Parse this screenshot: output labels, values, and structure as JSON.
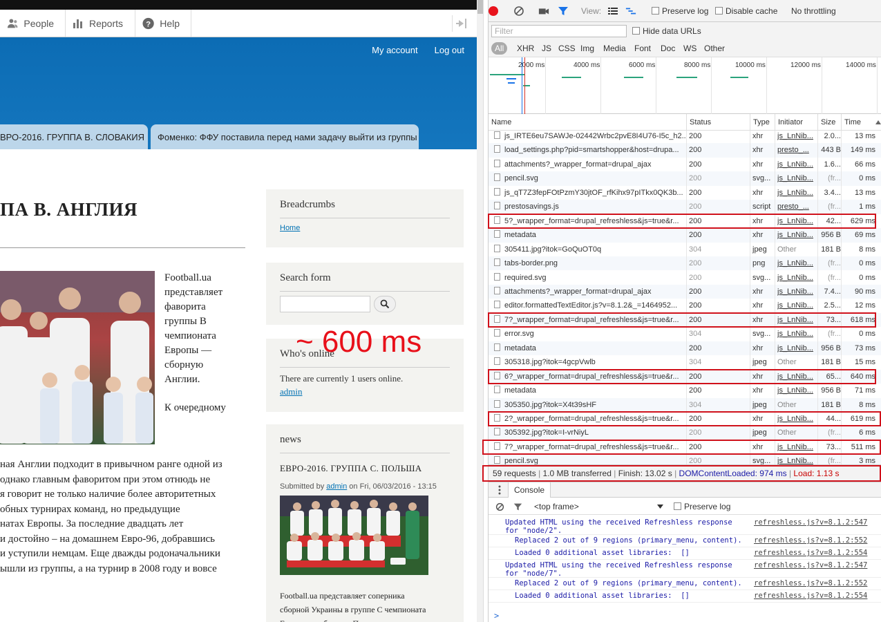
{
  "site": {
    "toolbar": {
      "people": "People",
      "reports": "Reports",
      "help": "Help"
    },
    "nav": {
      "my_account": "My account",
      "log_out": "Log out"
    },
    "tabs": [
      "ВРО-2016. ГРУППА В. СЛОВАКИЯ",
      "Фоменко: ФФУ поставила перед нами задачу выйти из группы"
    ],
    "main_title": "ПА В. АНГЛИЯ",
    "lead_lines": [
      "Football.ua",
      "представляет",
      "фаворита",
      "группы B",
      "чемпионата",
      "Европы —",
      "сборную",
      "Англии."
    ],
    "lead_cont": "К очередному",
    "body_lines": [
      "ная Англии подходит в привычном ранге одной из",
      "однако главным фаворитом при этом отнюдь не",
      "я говорит не только наличие более авторитетных",
      "обных турнирах команд, но предыдущие",
      "натах Европы. За последние двадцать лет",
      "и достойно – на домашнем Евро-96, добравшись",
      "и уступили немцам. Еще дважды родоначальники",
      "ышли из группы, а на турнир в 2008 году и вовсе"
    ],
    "blocks": {
      "breadcrumbs": {
        "title": "Breadcrumbs",
        "link": "Home"
      },
      "search": {
        "title": "Search form"
      },
      "online": {
        "title": "Who's online",
        "text": "There are currently 1 users online.",
        "user": "admin"
      },
      "news": {
        "title": "news",
        "item_title": "ЕВРО-2016. ГРУППА С. ПОЛЬША",
        "meta_prefix": "Submitted by",
        "meta_author": "admin",
        "meta_suffix": "on Fri, 06/03/2016 - 13:15",
        "text_lines": [
          "Football.ua представляет соперника",
          "сборной Украины в группе С чемпионата",
          "Европы — сборную Польши"
        ]
      }
    },
    "annotation": "~ 600 ms"
  },
  "devtools": {
    "toolbar": {
      "view": "View:",
      "preserve_log": "Preserve log",
      "disable_cache": "Disable cache",
      "throttling": "No throttling"
    },
    "filter": {
      "placeholder": "Filter",
      "hide_data_urls": "Hide data URLs"
    },
    "types": [
      "All",
      "XHR",
      "JS",
      "CSS",
      "Img",
      "Media",
      "Font",
      "Doc",
      "WS",
      "Other"
    ],
    "overview_ticks": [
      "2000 ms",
      "4000 ms",
      "6000 ms",
      "8000 ms",
      "10000 ms",
      "12000 ms",
      "14000 ms"
    ],
    "columns": [
      "Name",
      "Status",
      "Type",
      "Initiator",
      "Size",
      "Time"
    ],
    "rows": [
      {
        "name": "js_IRTE6eu7SAWJe-02442Wrbc2pvE8I4U76-I5c_h2...",
        "status": "200",
        "type": "xhr",
        "initiator": "js_LnNib...",
        "size": "2.0...",
        "time": "13 ms"
      },
      {
        "name": "load_settings.php?pid=smartshopper&host=drupa...",
        "status": "200",
        "type": "xhr",
        "initiator": "presto_...",
        "size": "443 B",
        "time": "149 ms"
      },
      {
        "name": "attachments?_wrapper_format=drupal_ajax",
        "status": "200",
        "type": "xhr",
        "initiator": "js_LnNib...",
        "size": "1.6...",
        "time": "66 ms"
      },
      {
        "name": "pencil.svg",
        "status": "200",
        "type": "svg...",
        "initiator": "js_LnNib...",
        "size": "(fr...",
        "time": "0 ms",
        "dim": true
      },
      {
        "name": "js_qT7Z3fepFOtPzmY30jtOF_rfKihx97pITkx0QK3b...",
        "status": "200",
        "type": "xhr",
        "initiator": "js_LnNib...",
        "size": "3.4...",
        "time": "13 ms"
      },
      {
        "name": "prestosavings.js",
        "status": "200",
        "type": "script",
        "initiator": "presto_...",
        "size": "(fr...",
        "time": "1 ms",
        "dim": true
      },
      {
        "name": "5?_wrapper_format=drupal_refreshless&js=true&r...",
        "status": "200",
        "type": "xhr",
        "initiator": "js_LnNib...",
        "size": "42...",
        "time": "629 ms"
      },
      {
        "name": "metadata",
        "status": "200",
        "type": "xhr",
        "initiator": "js_LnNib...",
        "size": "956 B",
        "time": "69 ms"
      },
      {
        "name": "305411.jpg?itok=GoQuOT0q",
        "status": "304",
        "type": "jpeg",
        "initiator": "Other",
        "size": "181 B",
        "time": "8 ms",
        "plainInit": true
      },
      {
        "name": "tabs-border.png",
        "status": "200",
        "type": "png",
        "initiator": "js_LnNib...",
        "size": "(fr...",
        "time": "0 ms",
        "dim": true
      },
      {
        "name": "required.svg",
        "status": "200",
        "type": "svg...",
        "initiator": "js_LnNib...",
        "size": "(fr...",
        "time": "0 ms",
        "dim": true
      },
      {
        "name": "attachments?_wrapper_format=drupal_ajax",
        "status": "200",
        "type": "xhr",
        "initiator": "js_LnNib...",
        "size": "7.4...",
        "time": "90 ms"
      },
      {
        "name": "editor.formattedTextEditor.js?v=8.1.2&_=1464952...",
        "status": "200",
        "type": "xhr",
        "initiator": "js_LnNib...",
        "size": "2.5...",
        "time": "12 ms"
      },
      {
        "name": "7?_wrapper_format=drupal_refreshless&js=true&r...",
        "status": "200",
        "type": "xhr",
        "initiator": "js_LnNib...",
        "size": "73...",
        "time": "618 ms"
      },
      {
        "name": "error.svg",
        "status": "304",
        "type": "svg...",
        "initiator": "js_LnNib...",
        "size": "(fr...",
        "time": "0 ms",
        "dim": true
      },
      {
        "name": "metadata",
        "status": "200",
        "type": "xhr",
        "initiator": "js_LnNib...",
        "size": "956 B",
        "time": "73 ms"
      },
      {
        "name": "305318.jpg?itok=4gcpVwlb",
        "status": "304",
        "type": "jpeg",
        "initiator": "Other",
        "size": "181 B",
        "time": "15 ms",
        "plainInit": true
      },
      {
        "name": "6?_wrapper_format=drupal_refreshless&js=true&r...",
        "status": "200",
        "type": "xhr",
        "initiator": "js_LnNib...",
        "size": "65...",
        "time": "640 ms"
      },
      {
        "name": "metadata",
        "status": "200",
        "type": "xhr",
        "initiator": "js_LnNib...",
        "size": "956 B",
        "time": "71 ms"
      },
      {
        "name": "305350.jpg?itok=X4t39sHF",
        "status": "304",
        "type": "jpeg",
        "initiator": "Other",
        "size": "181 B",
        "time": "8 ms",
        "plainInit": true
      },
      {
        "name": "2?_wrapper_format=drupal_refreshless&js=true&r...",
        "status": "200",
        "type": "xhr",
        "initiator": "js_LnNib...",
        "size": "44...",
        "time": "619 ms"
      },
      {
        "name": "305392.jpg?itok=I-vrNiyL",
        "status": "200",
        "type": "jpeg",
        "initiator": "Other",
        "size": "(fr...",
        "time": "6 ms",
        "dim": true,
        "plainInit": true
      },
      {
        "name": "7?_wrapper_format=drupal_refreshless&js=true&r...",
        "status": "200",
        "type": "xhr",
        "initiator": "js_LnNib...",
        "size": "73...",
        "time": "511 ms"
      },
      {
        "name": "pencil.svg",
        "status": "200",
        "type": "svg...",
        "initiator": "js_LnNib...",
        "size": "(fr...",
        "time": "3 ms",
        "dim": true
      }
    ],
    "highlight_rows": [
      6,
      13,
      17,
      20,
      22
    ],
    "summary": {
      "requests": "59 requests",
      "transferred": "1.0 MB transferred",
      "finish": "Finish: 13.02 s",
      "dcl": "DOMContentLoaded: 974 ms",
      "load": "Load: 1.13 s"
    },
    "console": {
      "tab": "Console",
      "frame": "<top frame>",
      "preserve_log": "Preserve log",
      "logs": [
        {
          "msg": "Updated HTML using the received Refreshless response\nfor \"node/2\".",
          "src": "refreshless.js?v=8.1.2:547",
          "indent": false
        },
        {
          "msg": "Replaced 2 out of 9 regions (primary_menu, content).",
          "src": "refreshless.js?v=8.1.2:552",
          "indent": true
        },
        {
          "msg": "Loaded 0 additional asset libraries:  []",
          "src": "refreshless.js?v=8.1.2:554",
          "indent": true
        },
        {
          "msg": "Updated HTML using the received Refreshless response\nfor \"node/7\".",
          "src": "refreshless.js?v=8.1.2:547",
          "indent": false
        },
        {
          "msg": "Replaced 2 out of 9 regions (primary_menu, content).",
          "src": "refreshless.js?v=8.1.2:552",
          "indent": true
        },
        {
          "msg": "Loaded 0 additional asset libraries:  []",
          "src": "refreshless.js?v=8.1.2:554",
          "indent": true
        }
      ],
      "prompt": ">"
    }
  }
}
